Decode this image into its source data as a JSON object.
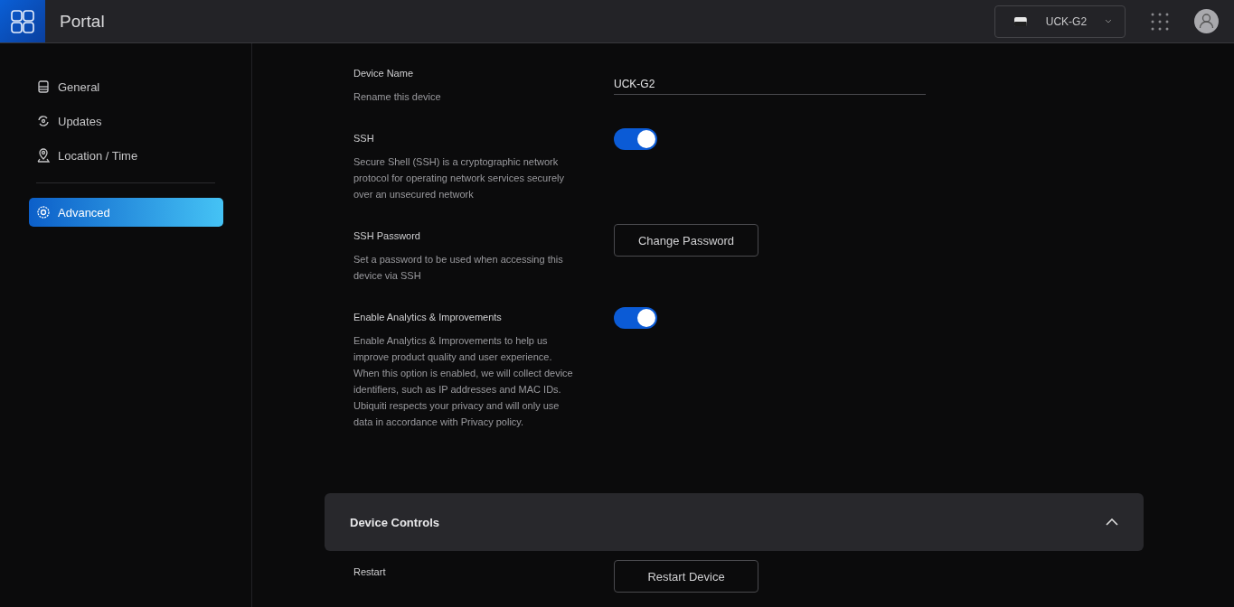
{
  "header": {
    "title": "Portal",
    "device": {
      "name": "UCK-G2"
    }
  },
  "sidebar": {
    "items": [
      {
        "label": "General",
        "kind": "device",
        "selected": false
      },
      {
        "label": "Updates",
        "kind": "updates",
        "selected": false
      },
      {
        "label": "Location / Time",
        "kind": "location",
        "selected": false
      },
      {
        "label": "Advanced",
        "kind": "gear",
        "selected": true,
        "divider_before": true
      }
    ]
  },
  "settings": [
    {
      "kind": "text",
      "label": "Device Name",
      "description": "Rename this device",
      "value": "UCK-G2"
    },
    {
      "kind": "toggle",
      "label": "SSH",
      "description": "Secure Shell (SSH) is a cryptographic network protocol for operating network services securely over an unsecured network",
      "on": true
    },
    {
      "kind": "button",
      "label": "SSH Password",
      "description": "Set a password to be used when accessing this device via SSH",
      "button": "Change Password"
    },
    {
      "kind": "toggle",
      "label": "Enable Analytics & Improvements",
      "description": "Enable Analytics & Improvements to help us improve product quality and user experience. When this option is enabled, we will collect device identifiers, such as IP addresses and MAC IDs. Ubiquiti respects your privacy and will only use data in accordance with Privacy policy.",
      "on": true
    }
  ],
  "device_controls": {
    "title": "Device Controls",
    "expanded": true,
    "rows": [
      {
        "kind": "button",
        "label": "Restart",
        "button": "Restart Device"
      }
    ]
  }
}
